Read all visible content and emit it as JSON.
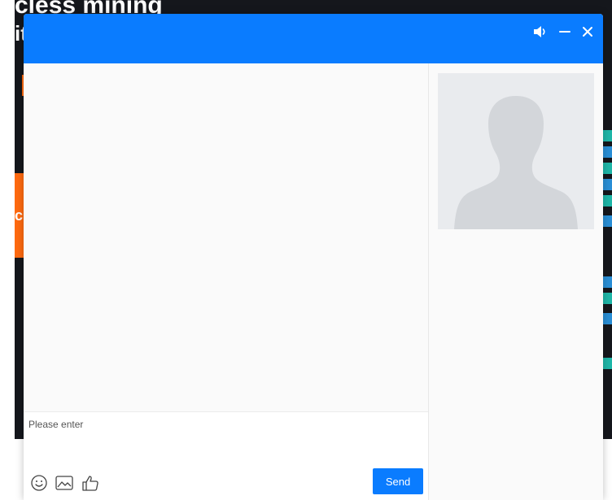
{
  "background_page": {
    "heading_line1": "cless mining",
    "heading_line2": "it",
    "button_fragment": "c"
  },
  "chat": {
    "header": {
      "controls": [
        {
          "name": "sound-icon"
        },
        {
          "name": "minimize-icon"
        },
        {
          "name": "close-icon"
        }
      ]
    },
    "input": {
      "placeholder": "Please enter",
      "value": ""
    },
    "toolbar": {
      "tools": [
        {
          "name": "emoji-icon"
        },
        {
          "name": "image-icon"
        },
        {
          "name": "thumbs-up-icon"
        }
      ]
    },
    "send_label": "Send"
  },
  "colors": {
    "accent": "#0a7cff",
    "panel_bg": "#fafafa",
    "page_dark": "#15171c",
    "page_orange": "#ff6a10",
    "avatar_bg": "#e9ebee",
    "avatar_silhouette": "#d3d6da"
  }
}
